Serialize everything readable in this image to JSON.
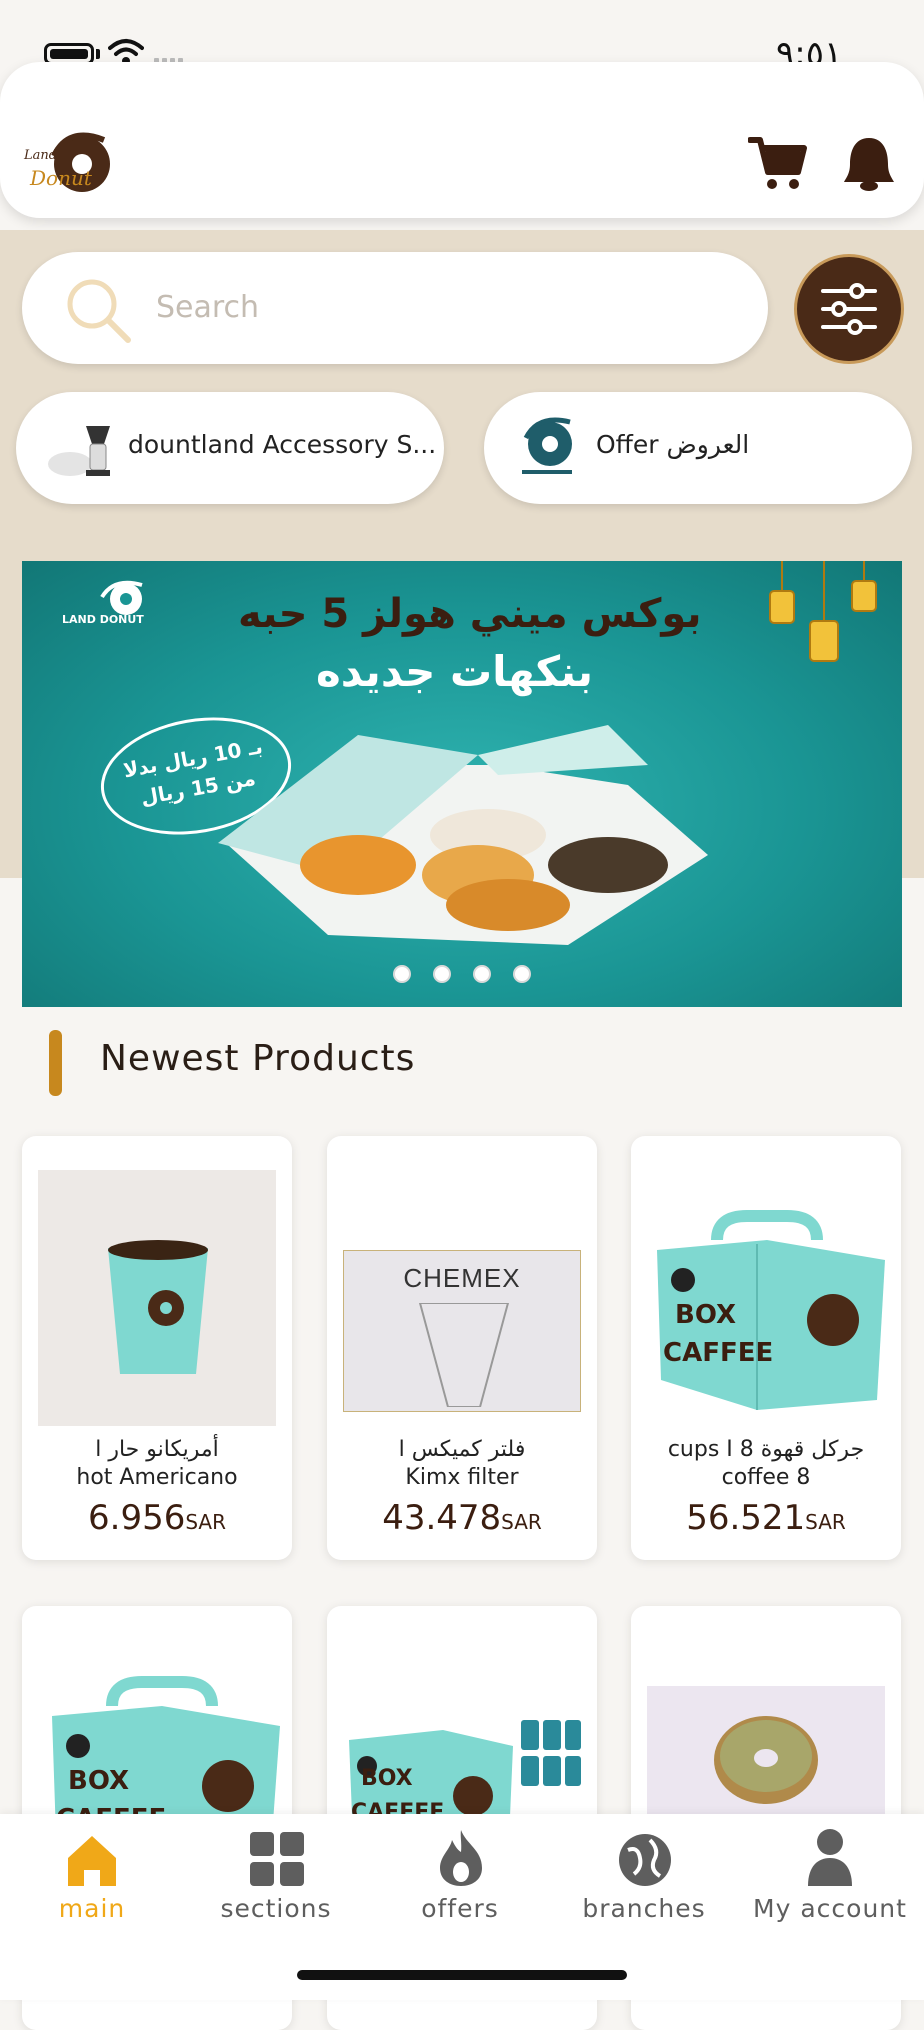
{
  "status_bar": {
    "time": "٩:٥١"
  },
  "header": {
    "logo_text_line1": "Land",
    "logo_text_line2": "Donut"
  },
  "search": {
    "placeholder": "Search"
  },
  "categories": [
    {
      "label": "dountland Accessory S..."
    },
    {
      "label": "Offer العروض"
    }
  ],
  "banner": {
    "title_line1": "بوكس ميني هولز 5 حبه",
    "title_line2": "بنكهات جديده",
    "price_line1": "بـ 10 ريال بدلا",
    "price_line2": "من 15 ريال",
    "brand": "LAND DONUT",
    "slides": 4,
    "active_slide": 0
  },
  "section": {
    "title": "Newest Products"
  },
  "products": [
    {
      "name_line1": "أمريكانو حار ا",
      "name_line2": "hot Americano",
      "price": "6.956",
      "currency": "SAR"
    },
    {
      "name_line1": "فلتر كميكس ا",
      "name_line2": "Kimx filter",
      "price": "43.478",
      "currency": "SAR",
      "image_text": "CHEMEX"
    },
    {
      "name_line1": "cups I 8 جركل قهوة",
      "name_line2": "coffee 8",
      "price": "56.521",
      "currency": "SAR",
      "image_text_line1": "BOX",
      "image_text_line2": "CAFFEE"
    }
  ],
  "products_row2": [
    {
      "image_text_line1": "BOX",
      "image_text_line2": "CAFFEE"
    },
    {
      "image_text_line1": "BOX",
      "image_text_line2": "CAFFEE"
    },
    {}
  ],
  "nav": {
    "items": [
      {
        "label": "main",
        "icon": "home-icon",
        "active": true
      },
      {
        "label": "sections",
        "icon": "grid-icon"
      },
      {
        "label": "offers",
        "icon": "fire-icon"
      },
      {
        "label": "branches",
        "icon": "globe-icon"
      },
      {
        "label": "My account",
        "icon": "user-icon"
      }
    ]
  },
  "colors": {
    "accent": "#f0a818",
    "brand_brown": "#4a2a17",
    "beige": "#e6dccb",
    "teal": "#1a9594",
    "section_accent": "#c7881e"
  }
}
